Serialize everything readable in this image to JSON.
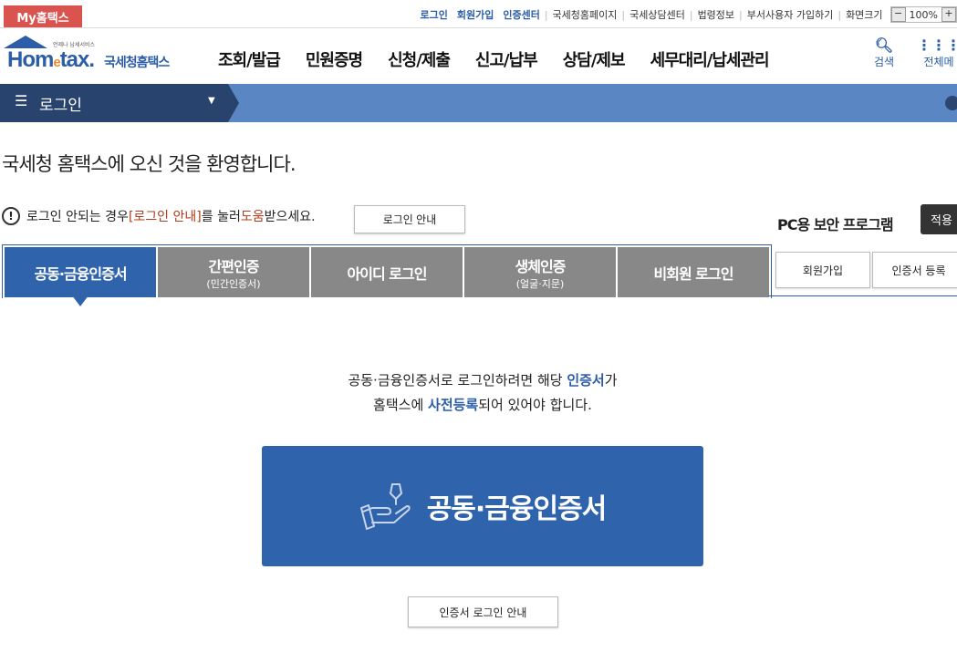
{
  "topbar": {
    "my_tab": "My홈택스",
    "links_blue": [
      "로그인",
      "회원가입",
      "인증센터"
    ],
    "links": [
      "국세청홈페이지",
      "국세상담센터",
      "법령정보",
      "부서사용자 가입하기"
    ],
    "screen_size_label": "화면크기",
    "zoom_value": "100%",
    "zoom_minus": "−",
    "zoom_plus": "+"
  },
  "header": {
    "logo_small": "언제나 납세서비스",
    "logo_brand_pre": "Hom",
    "logo_brand_e": "e",
    "logo_brand_post": "tax.",
    "logo_nts": "국세청홈택스",
    "menu": [
      "조회/발급",
      "민원증명",
      "신청/제출",
      "신고/납부",
      "상담/제보",
      "세무대리/납세관리"
    ],
    "search_label": "검색",
    "allmenu_label": "전체메"
  },
  "breadcrumb": {
    "label": "로그인"
  },
  "welcome": "국세청 홈택스에 오신 것을 환영합니다.",
  "help": {
    "prefix": "로그인 안되는 경우 ",
    "link": "[로그인 안내]",
    "mid": "를 눌러 ",
    "em": "도움",
    "suffix": "받으세요.",
    "button": "로그인 안내"
  },
  "pc_security": {
    "label": "PC용 보안 프로그램",
    "button": "적용"
  },
  "tabs": [
    {
      "title": "공동·금융인증서",
      "sub": ""
    },
    {
      "title": "간편인증",
      "sub": "(민간인증서)"
    },
    {
      "title": "아이디 로그인",
      "sub": ""
    },
    {
      "title": "생체인증",
      "sub": "(얼굴·지문)"
    },
    {
      "title": "비회원 로그인",
      "sub": ""
    }
  ],
  "side_buttons": {
    "signup": "회원가입",
    "cert_register": "인증서 등록"
  },
  "info": {
    "line1_pre": "공동·금융인증서로 로그인하려면 해당 ",
    "line1_em": "인증서",
    "line1_post": "가",
    "line2_pre": "홈택스에 ",
    "line2_em": "사전등록",
    "line2_post": "되어 있어야 합니다."
  },
  "big_button": {
    "label": "공동·금융인증서",
    "icon": "hand-certificate-icon"
  },
  "cert_guide_button": "인증서 로그인 안내",
  "colors": {
    "primary": "#2f64ad",
    "dark_bar": "#28436e",
    "my_tab": "#d9534f",
    "accent_red": "#b33a1b"
  }
}
